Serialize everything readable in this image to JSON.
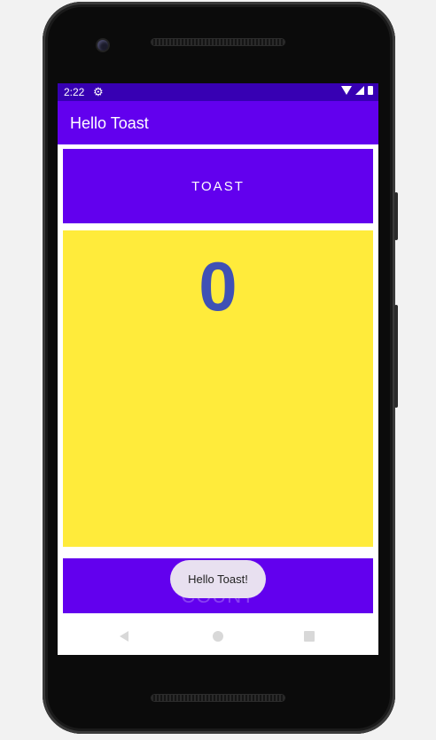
{
  "status_bar": {
    "time": "2:22",
    "settings_icon": "gear-icon",
    "wifi_icon": "wifi-icon",
    "signal_icon": "signal-icon",
    "battery_icon": "battery-icon"
  },
  "app_bar": {
    "title": "Hello Toast"
  },
  "main": {
    "toast_button_label": "TOAST",
    "count_value": "0",
    "count_button_label": "COUNT"
  },
  "toast": {
    "message": "Hello Toast!"
  },
  "nav_bar": {
    "back_icon": "back-icon",
    "home_icon": "home-icon",
    "recents_icon": "recents-icon"
  },
  "colors": {
    "primary": "#6200ee",
    "primary_dark": "#3700b3",
    "count_bg": "#ffeb3b",
    "count_text": "#3f51b5"
  }
}
